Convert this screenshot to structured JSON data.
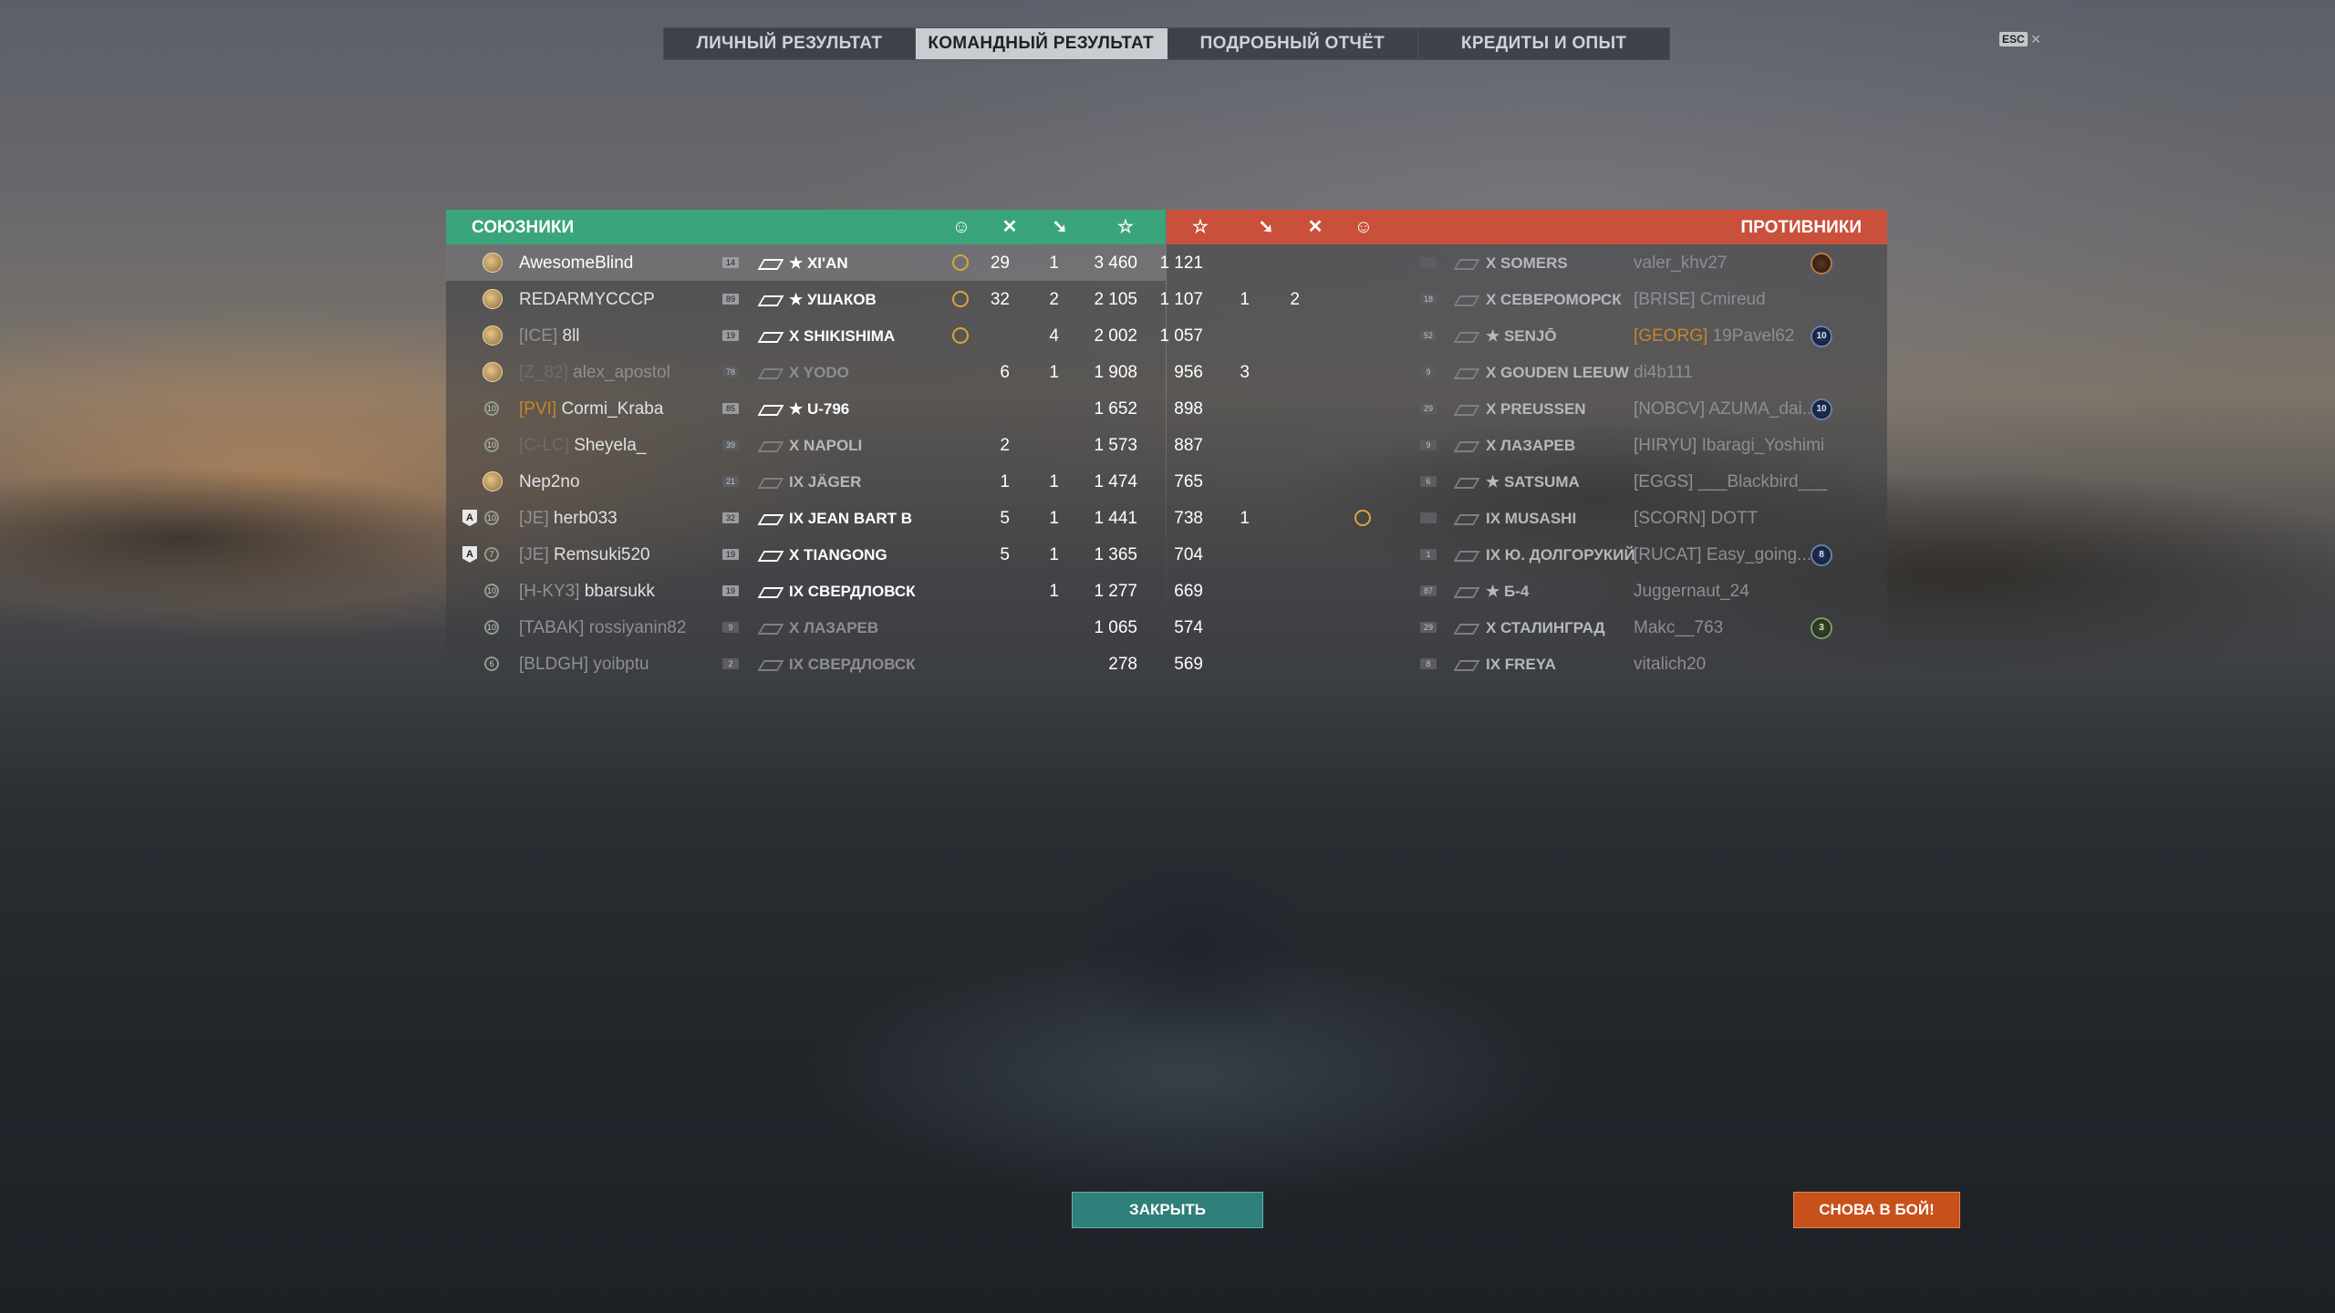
{
  "tabs": [
    "ЛИЧНЫЙ РЕЗУЛЬТАТ",
    "КОМАНДНЫЙ РЕЗУЛЬТАТ",
    "ПОДРОБНЫЙ ОТЧЁТ",
    "КРЕДИТЫ И ОПЫТ"
  ],
  "active_tab": 1,
  "esc": {
    "key": "ESC",
    "close": "×"
  },
  "allies": {
    "title": "СОЮЗНИКИ",
    "rows": [
      {
        "clan": "",
        "name": "AwesomeBlind",
        "lvl": "14",
        "ship": "★ XI'AN",
        "res": "29",
        "frags": "1",
        "xp": "3 460"
      },
      {
        "clan": "",
        "name": "REDARMYCCCP",
        "lvl": "89",
        "ship": "★ УШАКОВ",
        "res": "32",
        "frags": "2",
        "xp": "2 105"
      },
      {
        "clan": "[ICE]",
        "name": "8ll",
        "lvl": "19",
        "ship": "X SHIKISHIMA",
        "res": "",
        "frags": "4",
        "xp": "2 002"
      },
      {
        "clan": "[Z_82]",
        "name": "alex_apostol",
        "lvl": "78",
        "ship": "X YODO",
        "res": "6",
        "frags": "1",
        "xp": "1 908"
      },
      {
        "clan": "[PVI]",
        "name": "Cormi_Kraba",
        "lvl": "85",
        "ship": "★ U-796",
        "res": "",
        "frags": "",
        "xp": "1 652"
      },
      {
        "clan": "[C-LC]",
        "name": "Sheyela_",
        "lvl": "39",
        "ship": "X NAPOLI",
        "res": "2",
        "frags": "",
        "xp": "1 573"
      },
      {
        "clan": "",
        "name": "Nep2no",
        "lvl": "21",
        "ship": "IX JÄGER",
        "res": "1",
        "frags": "1",
        "xp": "1 474"
      },
      {
        "clan": "[JE]",
        "name": "herb033",
        "lvl": "32",
        "ship": "IX JEAN BART B",
        "res": "5",
        "frags": "1",
        "xp": "1 441"
      },
      {
        "clan": "[JE]",
        "name": "Remsuki520",
        "lvl": "19",
        "ship": "X TIANGONG",
        "res": "5",
        "frags": "1",
        "xp": "1 365"
      },
      {
        "clan": "[H-KY3]",
        "name": "bbarsukk",
        "lvl": "19",
        "ship": "IX СВЕРДЛОВСК",
        "res": "",
        "frags": "1",
        "xp": "1 277"
      },
      {
        "clan": "[TABAK]",
        "name": "rossiyanin82",
        "lvl": "9",
        "ship": "X ЛАЗАРЕВ",
        "res": "",
        "frags": "",
        "xp": "1 065"
      },
      {
        "clan": "[BLDGH]",
        "name": "yoibptu",
        "lvl": "2",
        "ship": "IX СВЕРДЛОВСК",
        "res": "",
        "frags": "",
        "xp": "278"
      }
    ],
    "rank_badges": [
      "",
      "",
      "",
      "",
      "10",
      "10",
      "",
      "10",
      "7",
      "10",
      "10",
      "6"
    ],
    "division_marks": [
      "",
      "",
      "",
      "",
      "",
      "",
      "",
      "A",
      "A",
      "",
      "",
      ""
    ]
  },
  "enemies": {
    "title": "ПРОТИВНИКИ",
    "rows": [
      {
        "clan": "",
        "name": "valer_khv27",
        "lvl": "",
        "ship": "X SOMERS",
        "xp": "1 121",
        "frags": "",
        "res": "",
        "medal": "bronze"
      },
      {
        "clan": "[BRISE]",
        "name": "Cmireud",
        "lvl": "18",
        "ship": "X СЕВЕРОМОРСК",
        "xp": "1 107",
        "frags": "1",
        "res": "2",
        "medal": ""
      },
      {
        "clan": "[GEORG]",
        "name": "19Pavel62",
        "lvl": "52",
        "ship": "★ SENJŌ",
        "xp": "1 057",
        "frags": "",
        "res": "",
        "medal": "10"
      },
      {
        "clan": "",
        "name": "di4b111",
        "lvl": "9",
        "ship": "X GOUDEN LEEUW",
        "xp": "956",
        "frags": "3",
        "res": "",
        "medal": ""
      },
      {
        "clan": "[NOBCV]",
        "name": "AZUMA_dai...",
        "lvl": "29",
        "ship": "X PREUSSEN",
        "xp": "898",
        "frags": "",
        "res": "",
        "medal": "10"
      },
      {
        "clan": "[HIRYU]",
        "name": "Ibaragi_Yoshimi",
        "lvl": "9",
        "ship": "X ЛАЗАРЕВ",
        "xp": "887",
        "frags": "",
        "res": "",
        "medal": ""
      },
      {
        "clan": "[EGGS]",
        "name": "___Blackbird___",
        "lvl": "6",
        "ship": "★ SATSUMA",
        "xp": "765",
        "frags": "",
        "res": "",
        "medal": ""
      },
      {
        "clan": "[SCORN]",
        "name": "DOTT",
        "lvl": "",
        "ship": "IX MUSASHI",
        "xp": "738",
        "frags": "1",
        "res": "",
        "medal": ""
      },
      {
        "clan": "[RUCAT]",
        "name": "Easy_going...",
        "lvl": "1",
        "ship": "IX Ю. ДОЛГОРУКИЙ",
        "xp": "704",
        "frags": "",
        "res": "",
        "medal": "8"
      },
      {
        "clan": "",
        "name": "Juggernaut_24",
        "lvl": "87",
        "ship": "★ Б-4",
        "xp": "669",
        "frags": "",
        "res": "",
        "medal": ""
      },
      {
        "clan": "",
        "name": "Makc__763",
        "lvl": "29",
        "ship": "X СТАЛИНГРАД",
        "xp": "574",
        "frags": "",
        "res": "",
        "medal": "3"
      },
      {
        "clan": "",
        "name": "vitalich20",
        "lvl": "8",
        "ship": "IX FREYA",
        "xp": "569",
        "frags": "",
        "res": "",
        "medal": ""
      }
    ]
  },
  "buttons": {
    "close": "ЗАКРЫТЬ",
    "again": "СНОВА В БОЙ!"
  },
  "colors": {
    "allies": "#3aa57a",
    "enemies": "#c9503b",
    "close_btn": "#2f7f7a",
    "again_btn": "#c8501a",
    "active_tab": "#c9ccd0"
  }
}
